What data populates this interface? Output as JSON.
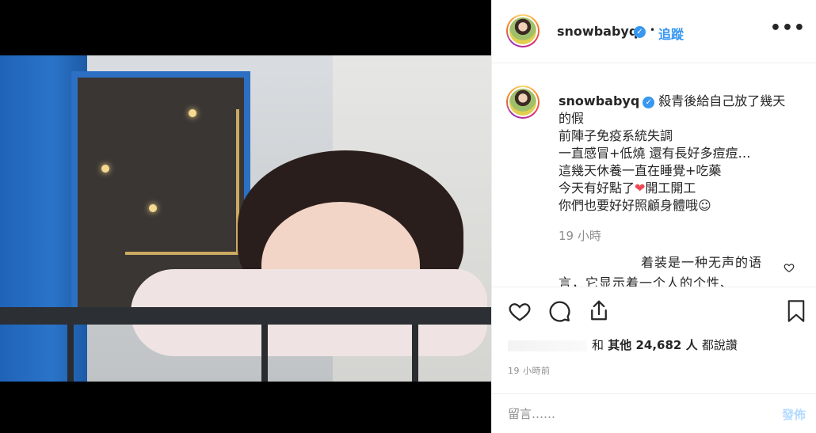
{
  "post": {
    "username": "snowbabyq",
    "verified_icon": "verified-badge-icon",
    "follow_label": "追蹤",
    "dot": "•",
    "more_label": "•••"
  },
  "caption": {
    "username": "snowbabyq",
    "lines": [
      "殺青後給自己放了幾天",
      "的假",
      "前陣子免疫系統失調",
      "一直感冒+低燒 還有長好多痘痘…",
      "這幾天休養一直在睡覺+吃藥",
      "今天有好點了",
      "開工開工",
      "你們也要好好照顧身體哦☺"
    ],
    "heart_emoji": "❤",
    "time": "19 小時"
  },
  "reply": {
    "text": "着装是一种无声的语言，它显示着一个人的个性、"
  },
  "actions": {
    "like_icon": "heart-icon",
    "comment_icon": "comment-icon",
    "share_icon": "share-icon",
    "save_icon": "bookmark-icon"
  },
  "likes": {
    "prefix": "和",
    "text": "其他 24,682 人",
    "suffix": "都說讚"
  },
  "posted_time": "19 小時前",
  "comment_box": {
    "placeholder": "留言……",
    "post_label": "發佈"
  },
  "colors": {
    "accent": "#3897f0",
    "muted": "#8e8e8e",
    "post_disabled": "#b3dbff",
    "heart": "#ed4956"
  }
}
